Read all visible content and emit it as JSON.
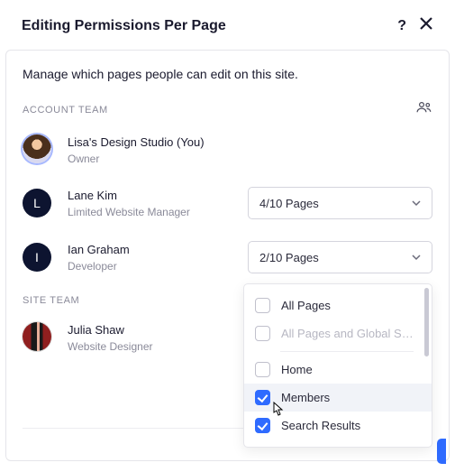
{
  "header": {
    "title": "Editing Permissions Per Page"
  },
  "description": "Manage which pages people can edit on this site.",
  "sections": {
    "account_team": "ACCOUNT TEAM",
    "site_team": "SITE TEAM"
  },
  "members": {
    "owner": {
      "name": "Lisa's Design Studio (You)",
      "role": "Owner"
    },
    "m1": {
      "name": "Lane Kim",
      "role": "Limited Website Manager",
      "initial": "L",
      "dropdown": "4/10 Pages"
    },
    "m2": {
      "name": "Ian Graham",
      "role": "Developer",
      "initial": "I",
      "dropdown": "2/10 Pages"
    },
    "s1": {
      "name": "Julia Shaw",
      "role": "Website Designer"
    }
  },
  "dropdown": {
    "all_pages": "All Pages",
    "all_pages_global": "All Pages and Global Se…",
    "home": "Home",
    "members": "Members",
    "search_results": "Search Results"
  }
}
